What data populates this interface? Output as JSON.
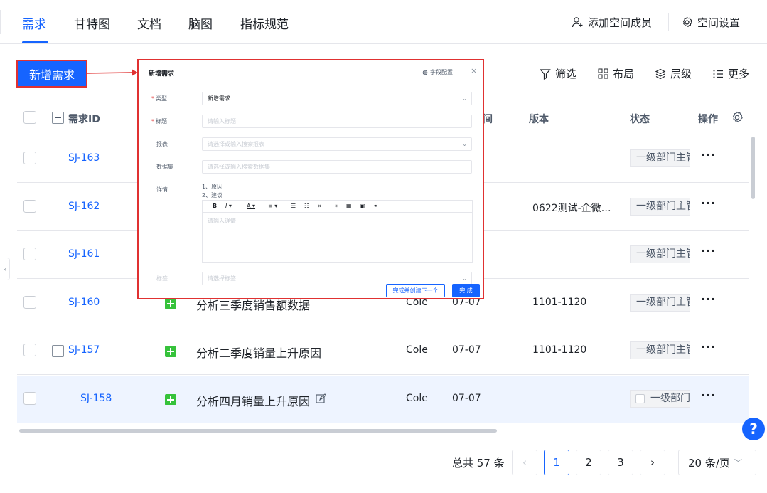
{
  "nav": {
    "tabs": [
      {
        "label": "需求"
      },
      {
        "label": "甘特图"
      },
      {
        "label": "文档"
      },
      {
        "label": "脑图"
      },
      {
        "label": "指标规范"
      }
    ],
    "add_member": "添加空间成员",
    "space_settings": "空间设置"
  },
  "toolbar": {
    "new_button": "新增需求",
    "filter": "筛选",
    "layout": "布局",
    "level": "层级",
    "more": "更多"
  },
  "table": {
    "headers": {
      "id": "需求ID",
      "version": "版本",
      "status": "状态",
      "action": "操作",
      "time_partial": "间"
    },
    "rows": [
      {
        "id": "SJ-163",
        "title": "",
        "owner": "",
        "date": "",
        "version": "",
        "status": "一级部门主管"
      },
      {
        "id": "SJ-162",
        "title": "",
        "owner": "",
        "date": "",
        "version": "0622测试-企微…",
        "status": "一级部门主管"
      },
      {
        "id": "SJ-161",
        "title": "",
        "owner": "",
        "date": "",
        "version": "",
        "status": "一级部门主管"
      },
      {
        "id": "SJ-160",
        "title": "分析三季度销售额数据",
        "owner": "Cole",
        "date": "07-07",
        "version": "1101-1120",
        "status": "一级部门主管"
      },
      {
        "id": "SJ-157",
        "title": "分析二季度销量上升原因",
        "owner": "Cole",
        "date": "07-07",
        "version": "1101-1120",
        "status": "一级部门主管"
      },
      {
        "id": "SJ-158",
        "title": "分析四月销量上升原因",
        "owner": "Cole",
        "date": "07-07",
        "version": "",
        "status": "一级部门主"
      }
    ],
    "more_glyph": "···"
  },
  "pagination": {
    "total": "总共 57 条",
    "pages": [
      "1",
      "2",
      "3"
    ],
    "page_size": "20 条/页"
  },
  "help": "?",
  "modal": {
    "title": "新增需求",
    "field_config": "字段配置",
    "close": "×",
    "fields": {
      "type_label": "类型",
      "type_value": "新增需求",
      "title_label": "标题",
      "title_placeholder": "请输入标题",
      "report_label": "报表",
      "report_placeholder": "请选择或输入搜索报表",
      "dataset_label": "数据集",
      "dataset_placeholder": "请选择或输入搜索数据集",
      "detail_label": "详情",
      "detail_line1": "1、原因",
      "detail_line2": "2、建议",
      "detail_placeholder": "请输入详情",
      "tag_label": "标签",
      "tag_placeholder": "请选择标签"
    },
    "create_next": "完成并创建下一个",
    "done": "完 成"
  },
  "colors": {
    "accent": "#1664ff",
    "highlight": "#e03131",
    "green": "#36c23b"
  }
}
